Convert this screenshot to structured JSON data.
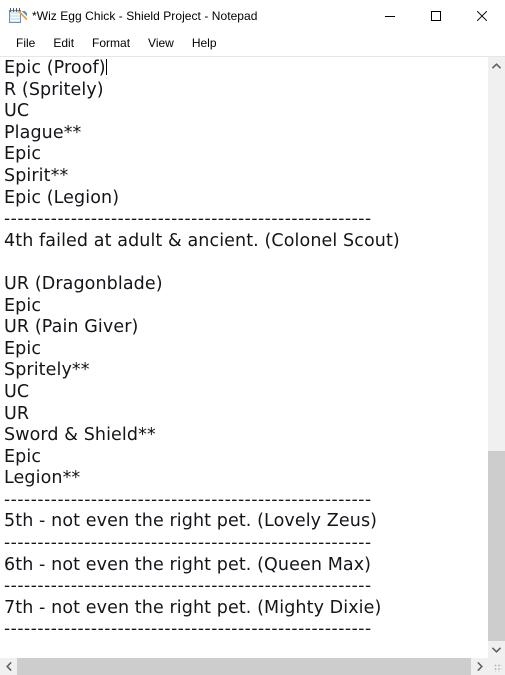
{
  "window": {
    "title": "*Wiz Egg Chick - Shield Project - Notepad",
    "app_icon": "notepad-icon",
    "controls": {
      "minimize": "minimize-icon",
      "maximize": "maximize-icon",
      "close": "close-icon"
    }
  },
  "menu": {
    "items": [
      {
        "label": "File"
      },
      {
        "label": "Edit"
      },
      {
        "label": "Format"
      },
      {
        "label": "View"
      },
      {
        "label": "Help"
      }
    ]
  },
  "editor": {
    "separator": "-------------------------------------------------------",
    "caret_after_line": 0,
    "lines": [
      "Epic (Proof)",
      "R (Spritely)",
      "UC",
      "Plague**",
      "Epic",
      "Spirit**",
      "Epic (Legion)",
      "-------------------------------------------------------",
      "4th failed at adult & ancient. (Colonel Scout)",
      "",
      "UR (Dragonblade)",
      "Epic",
      "UR (Pain Giver)",
      "Epic",
      "Spritely**",
      "UC",
      "UR",
      "Sword & Shield**",
      "Epic",
      "Legion**",
      "-------------------------------------------------------",
      "5th - not even the right pet. (Lovely Zeus)",
      "-------------------------------------------------------",
      "6th - not even the right pet. (Queen Max)",
      "-------------------------------------------------------",
      "7th - not even the right pet. (Mighty Dixie)",
      "-------------------------------------------------------"
    ]
  },
  "scrollbars": {
    "vertical": {
      "up_arrow": "chevron-up-icon",
      "down_arrow": "chevron-down-icon",
      "thumb_top_pct": 66.5,
      "thumb_height_pct": 33.5
    },
    "horizontal": {
      "left_arrow": "chevron-left-icon",
      "right_arrow": "chevron-right-icon",
      "thumb_left_pct": 0,
      "thumb_width_pct": 100
    },
    "grip": "resize-grip-icon"
  },
  "colors": {
    "window_bg": "#ffffff",
    "text": "#14151a",
    "scroll_track": "#f0f0f0",
    "scroll_thumb": "#cdcdcd",
    "arrow": "#606060"
  }
}
